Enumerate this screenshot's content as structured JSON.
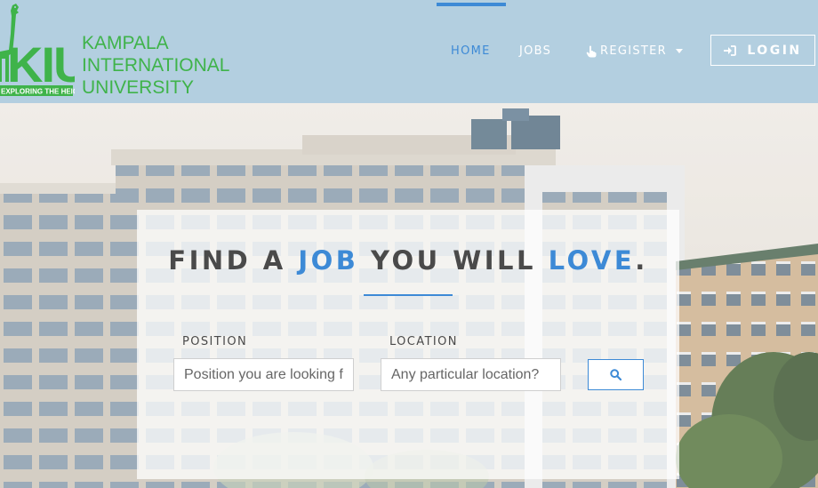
{
  "brand": {
    "logo_letters": "KIU",
    "tagline": "EXPLORING THE HEIGHTS",
    "name_lines": [
      "KAMPALA",
      "INTERNATIONAL",
      "UNIVERSITY"
    ]
  },
  "nav": {
    "home": "HOME",
    "jobs": "JOBS",
    "register": "REGISTER",
    "login": "LOGIN",
    "active_item": "HOME"
  },
  "hero": {
    "headline_parts": [
      "FIND A ",
      "JOB",
      " YOU WILL ",
      "LOVE",
      "."
    ],
    "position_label": "POSITION",
    "location_label": "LOCATION",
    "position_placeholder": "Position you are looking for",
    "location_placeholder": "Any particular location?"
  },
  "icons": {
    "register": "hand-pointer-icon",
    "login": "sign-in-icon",
    "search": "search-icon"
  },
  "colors": {
    "header_bg": "#b3cfe0",
    "accent": "#3d8ad6",
    "brand_green": "#3fb34a",
    "text_dark": "#4a4a4a"
  }
}
